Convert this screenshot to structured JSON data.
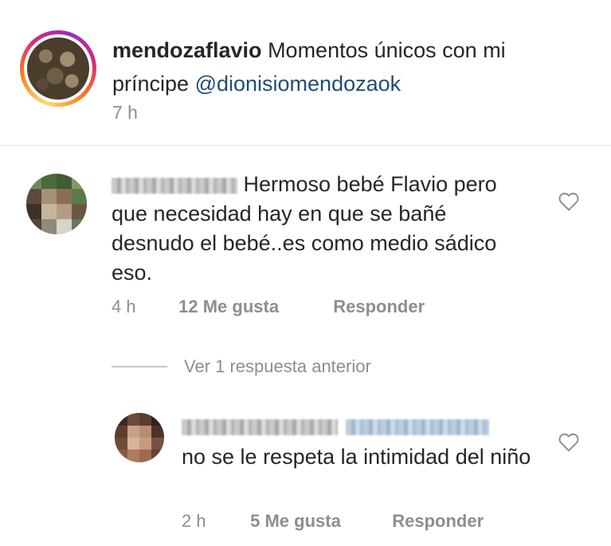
{
  "caption": {
    "username": "mendozaflavio",
    "text": "Momentos únicos con mi príncipe",
    "mention": "@dionisiomendozaok",
    "time": "7 h"
  },
  "comments": [
    {
      "text": "Hermoso bebé Flavio pero que necesidad hay en que se bañé desnudo el bebé..es como medio sádico eso.",
      "time": "4 h",
      "likes": "12 Me gusta",
      "reply_label": "Responder",
      "like_icon": "heart-outline-icon"
    }
  ],
  "view_replies": {
    "label": "Ver 1 respuesta anterior"
  },
  "reply": {
    "text": "no se le respeta la intimidad del niño",
    "time": "2 h",
    "likes": "5 Me gusta",
    "reply_label": "Responder",
    "like_icon": "heart-outline-icon"
  },
  "colors": {
    "text": "#262626",
    "secondary": "#8e8e8e",
    "mention": "#1f4d78",
    "divider": "#e6e6e6"
  }
}
